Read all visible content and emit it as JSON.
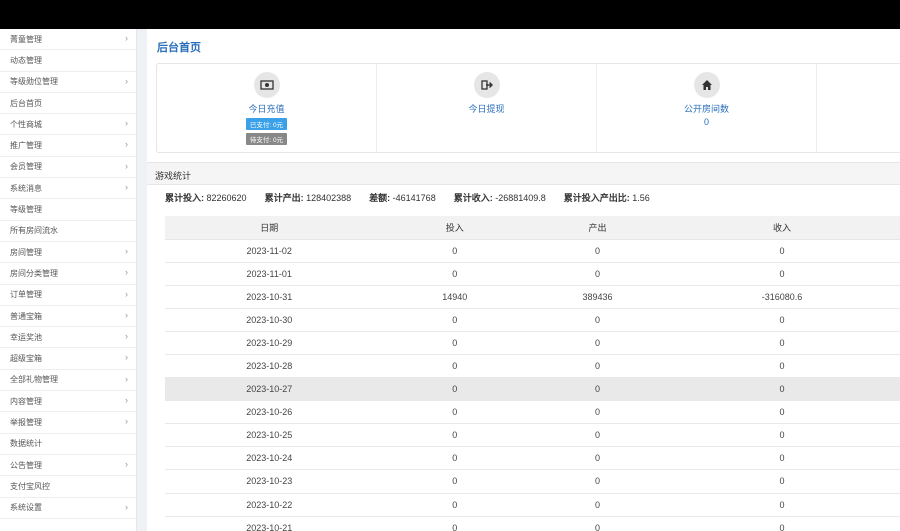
{
  "sidebar": {
    "items": [
      {
        "label": "菁童管理",
        "chevron": true
      },
      {
        "label": "动态管理",
        "chevron": false
      },
      {
        "label": "等级勋位管理",
        "chevron": true
      },
      {
        "label": "后台首页",
        "chevron": false
      },
      {
        "label": "个性商城",
        "chevron": true
      },
      {
        "label": "推广管理",
        "chevron": true
      },
      {
        "label": "会员管理",
        "chevron": true
      },
      {
        "label": "系统消息",
        "chevron": true
      },
      {
        "label": "等级管理",
        "chevron": false
      },
      {
        "label": "所有房间流水",
        "chevron": false
      },
      {
        "label": "房间管理",
        "chevron": true
      },
      {
        "label": "房间分类管理",
        "chevron": true
      },
      {
        "label": "订单管理",
        "chevron": true
      },
      {
        "label": "普通宝箱",
        "chevron": true
      },
      {
        "label": "幸运奖池",
        "chevron": true
      },
      {
        "label": "超级宝箱",
        "chevron": true
      },
      {
        "label": "全部礼物管理",
        "chevron": true
      },
      {
        "label": "内容管理",
        "chevron": true
      },
      {
        "label": "举报管理",
        "chevron": true
      },
      {
        "label": "数据统计",
        "chevron": false
      },
      {
        "label": "公告管理",
        "chevron": true
      },
      {
        "label": "支付宝风控",
        "chevron": false
      },
      {
        "label": "系统设置",
        "chevron": true
      }
    ]
  },
  "page_title": "后台首页",
  "cards": [
    {
      "icon": "recharge-icon",
      "label": "今日充值",
      "tags": [
        {
          "text": "已支付: 0元",
          "color": "#3aa0e8"
        },
        {
          "text": "待支付: 0元",
          "color": "#888888"
        }
      ]
    },
    {
      "icon": "withdraw-icon",
      "label": "今日提现"
    },
    {
      "icon": "home-icon",
      "label": "公开房间数",
      "value": "0"
    }
  ],
  "stats": {
    "header": "游戏统计",
    "summary": [
      {
        "label": "累计投入:",
        "value": "82260620"
      },
      {
        "label": "累计产出:",
        "value": "128402388"
      },
      {
        "label": "差额:",
        "value": "-46141768"
      },
      {
        "label": "累计收入:",
        "value": "-26881409.8"
      },
      {
        "label": "累计投入产出比:",
        "value": "1.56"
      }
    ],
    "columns": [
      "日期",
      "投入",
      "产出",
      "收入"
    ],
    "rows": [
      [
        "2023-11-02",
        "0",
        "0",
        "0"
      ],
      [
        "2023-11-01",
        "0",
        "0",
        "0"
      ],
      [
        "2023-10-31",
        "14940",
        "389436",
        "-316080.6"
      ],
      [
        "2023-10-30",
        "0",
        "0",
        "0"
      ],
      [
        "2023-10-29",
        "0",
        "0",
        "0"
      ],
      [
        "2023-10-28",
        "0",
        "0",
        "0"
      ],
      [
        "2023-10-27",
        "0",
        "0",
        "0"
      ],
      [
        "2023-10-26",
        "0",
        "0",
        "0"
      ],
      [
        "2023-10-25",
        "0",
        "0",
        "0"
      ],
      [
        "2023-10-24",
        "0",
        "0",
        "0"
      ],
      [
        "2023-10-23",
        "0",
        "0",
        "0"
      ],
      [
        "2023-10-22",
        "0",
        "0",
        "0"
      ],
      [
        "2023-10-21",
        "0",
        "0",
        "0"
      ]
    ],
    "highlight_row": 6
  }
}
